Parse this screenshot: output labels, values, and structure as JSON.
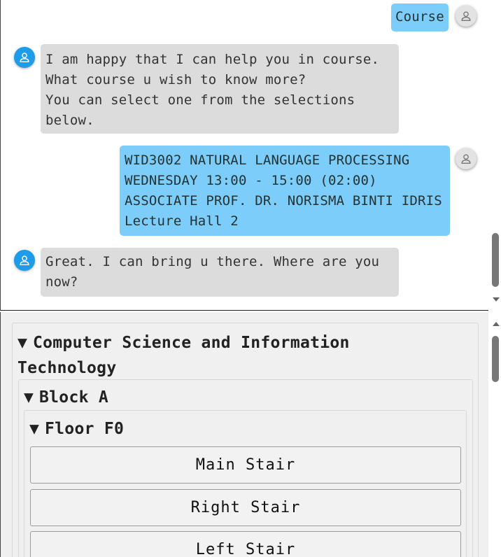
{
  "chat": {
    "messages": [
      {
        "role": "user",
        "text": "Course"
      },
      {
        "role": "bot",
        "text": "I am happy that I can help you in course.\nWhat course u wish to know more?\nYou can select one from the selections\nbelow."
      },
      {
        "role": "user",
        "text": "WID3002 NATURAL LANGUAGE PROCESSING\nWEDNESDAY 13:00 - 15:00 (02:00)\nASSOCIATE PROF. DR. NORISMA BINTI IDRIS\nLecture Hall 2"
      },
      {
        "role": "bot",
        "text": "Great. I can bring u there. Where are you\nnow?"
      }
    ]
  },
  "selection": {
    "faculty": {
      "triangle": "▼",
      "label": "Computer Science and Information\nTechnology"
    },
    "block": {
      "triangle": "▼",
      "label": "Block A"
    },
    "floor": {
      "triangle": "▼",
      "label": "Floor F0"
    },
    "options": [
      "Main Stair",
      "Right Stair",
      "Left Stair"
    ]
  },
  "colors": {
    "bot_bubble": "#dcdcdc",
    "user_bubble": "#7dcdfb",
    "bot_avatar": "#1e9be9",
    "user_avatar": "#e3e3e3"
  },
  "icons": {
    "bot_avatar": "person-icon",
    "user_avatar": "person-icon",
    "scroll_down": "triangle-down-icon",
    "scroll_up": "triangle-up-icon"
  }
}
